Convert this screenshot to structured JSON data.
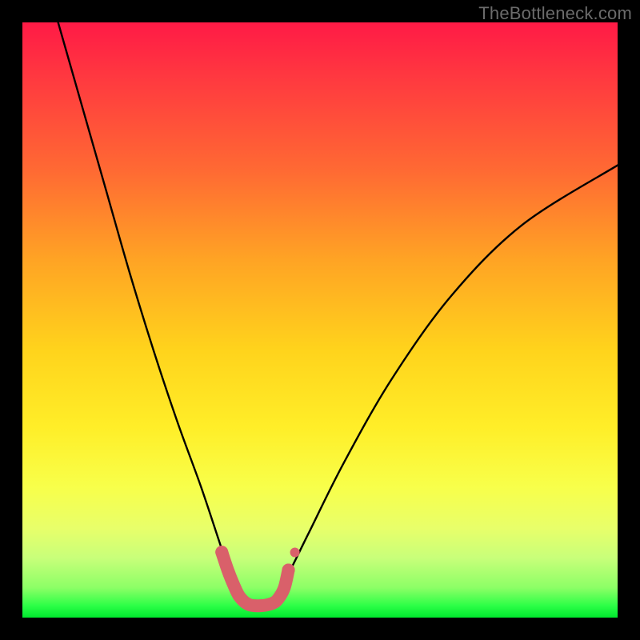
{
  "watermark": "TheBottleneck.com",
  "chart_data": {
    "type": "line",
    "title": "",
    "xlabel": "",
    "ylabel": "",
    "xlim": [
      0,
      100
    ],
    "ylim": [
      0,
      100
    ],
    "series": [
      {
        "name": "bottleneck-curve",
        "x": [
          6,
          10,
          14,
          18,
          22,
          26,
          30,
          33,
          35,
          36.5,
          38,
          40,
          42,
          44,
          48,
          54,
          62,
          72,
          84,
          100
        ],
        "y": [
          100,
          86,
          72,
          58,
          45,
          33,
          22,
          13,
          7,
          3,
          2,
          2,
          3,
          6,
          14,
          26,
          40,
          54,
          66,
          76
        ]
      }
    ],
    "markers": {
      "name": "highlight-band",
      "color": "#d9606a",
      "x": [
        33.5,
        34.5,
        35.5,
        36.5,
        38,
        40,
        42,
        43,
        44,
        44.7
      ],
      "y": [
        11,
        8,
        5.5,
        3.5,
        2.2,
        2,
        2.4,
        3.2,
        5,
        8
      ]
    },
    "background_gradient": {
      "top": "#ff1a46",
      "mid": "#ffee28",
      "bottom": "#00e82e"
    }
  }
}
